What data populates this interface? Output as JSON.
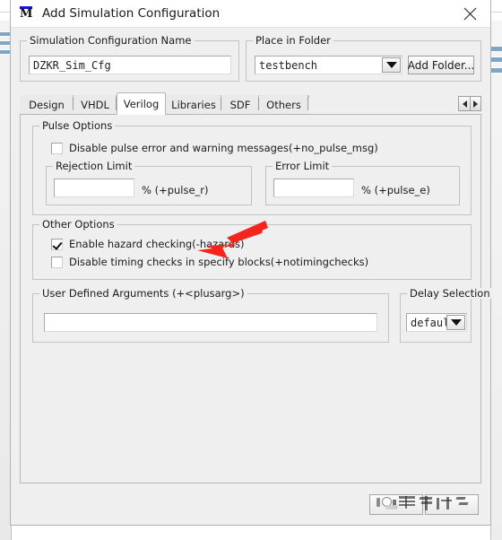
{
  "window": {
    "title": "Add Simulation Configuration",
    "app_icon": "modelsim-m-icon",
    "icon_letter": "M",
    "close_icon": "close-icon"
  },
  "sim_config_name_group": {
    "legend": "Simulation Configuration Name",
    "value": "DZKR_Sim_Cfg",
    "placeholder": ""
  },
  "place_in_folder_group": {
    "legend": "Place in Folder",
    "selected": "testbench",
    "dropdown_icon": "chevron-down-icon",
    "add_folder_label": "Add Folder..."
  },
  "tabs": {
    "items": [
      {
        "label": "Design",
        "selected": false
      },
      {
        "label": "VHDL",
        "selected": false
      },
      {
        "label": "Verilog",
        "selected": true
      },
      {
        "label": "Libraries",
        "selected": false
      },
      {
        "label": "SDF",
        "selected": false
      },
      {
        "label": "Others",
        "selected": false
      }
    ],
    "scroll_left_icon": "chevron-left-icon",
    "scroll_right_icon": "chevron-right-icon"
  },
  "pulse_options": {
    "legend": "Pulse Options",
    "disable_pulse_checkbox": {
      "label": "Disable pulse error and warning messages(+no_pulse_msg)",
      "checked": false
    },
    "rejection_limit": {
      "legend": "Rejection Limit",
      "value": "",
      "suffix": "% (+pulse_r)"
    },
    "error_limit": {
      "legend": "Error Limit",
      "value": "",
      "suffix": "% (+pulse_e)"
    }
  },
  "other_options": {
    "legend": "Other Options",
    "enable_hazard_checkbox": {
      "label": "Enable hazard checking(-hazards)",
      "checked": true
    },
    "disable_timing_checkbox": {
      "label": "Disable timing checks in specify blocks(+notimingchecks)",
      "checked": false
    }
  },
  "user_defined_arguments": {
    "legend": "User Defined Arguments (+<plusarg>)",
    "value": ""
  },
  "delay_selection": {
    "legend": "Delay Selection",
    "selected": "default",
    "dropdown_icon": "chevron-down-icon"
  },
  "annotation": {
    "type": "red-arrow",
    "color": "#f5241c",
    "points_to": "Enable hazard checking(-hazards)"
  },
  "colors": {
    "dialog_background": "#efefef",
    "titlebar_background": "#ffffff",
    "group_border": "#c2c2c2",
    "selected_tab_background": "#ffffff",
    "annotation_red": "#f5241c",
    "icon_blue": "#1414e0"
  }
}
